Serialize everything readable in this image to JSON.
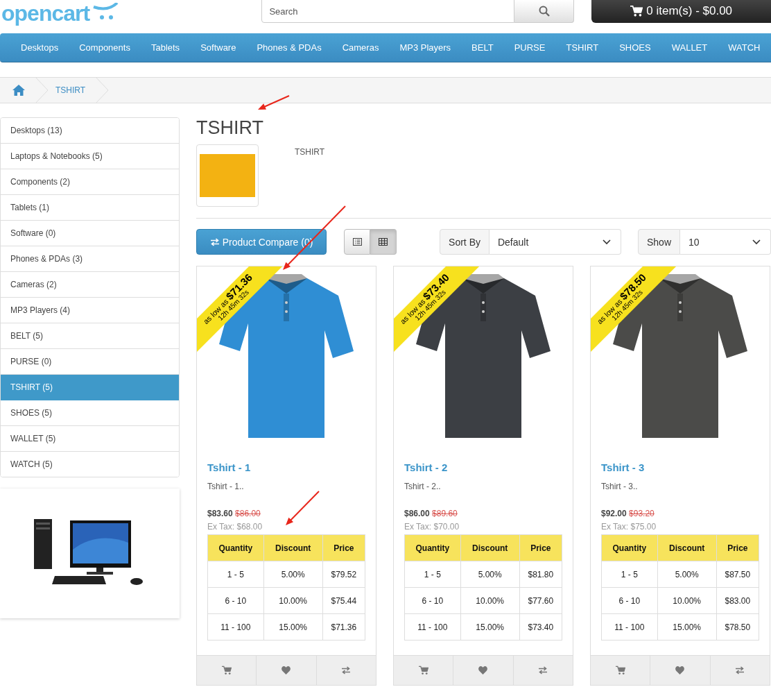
{
  "header": {
    "logo": "opencart",
    "search": {
      "placeholder": "Search"
    },
    "cart": "0 item(s) - $0.00"
  },
  "menu": [
    "Desktops",
    "Components",
    "Tablets",
    "Software",
    "Phones & PDAs",
    "Cameras",
    "MP3 Players",
    "BELT",
    "PURSE",
    "TSHIRT",
    "SHOES",
    "WALLET",
    "WATCH"
  ],
  "breadcrumb": [
    "TSHIRT"
  ],
  "categories": [
    {
      "label": "Desktops (13)",
      "selected": false
    },
    {
      "label": "Laptops & Notebooks (5)",
      "selected": false
    },
    {
      "label": "Components (2)",
      "selected": false
    },
    {
      "label": "Tablets (1)",
      "selected": false
    },
    {
      "label": "Software (0)",
      "selected": false
    },
    {
      "label": "Phones & PDAs (3)",
      "selected": false
    },
    {
      "label": "Cameras (2)",
      "selected": false
    },
    {
      "label": "MP3 Players (4)",
      "selected": false
    },
    {
      "label": "BELT (5)",
      "selected": false
    },
    {
      "label": "PURSE (0)",
      "selected": false
    },
    {
      "label": "TSHIRT (5)",
      "selected": true
    },
    {
      "label": "SHOES (5)",
      "selected": false
    },
    {
      "label": "WALLET (5)",
      "selected": false
    },
    {
      "label": "WATCH (5)",
      "selected": false
    }
  ],
  "category": {
    "title": "TSHIRT",
    "description": "TSHIRT"
  },
  "toolbar": {
    "compare": "Product Compare (0)",
    "views": [
      {
        "kind": "list",
        "selected": false
      },
      {
        "kind": "grid",
        "selected": true
      }
    ],
    "sort": {
      "label": "Sort By",
      "value": "Default"
    },
    "limit": {
      "label": "Show",
      "value": "10"
    }
  },
  "products": [
    {
      "name": "Tshirt - 1",
      "description": "Tshirt - 1..",
      "price": "$83.60",
      "old_price": "$86.00",
      "ex_tax": "Ex Tax: $68.00",
      "color": "#2f8ed4",
      "ribbon": {
        "offer": "as low as **$71.36**",
        "countdown": "12h 45m 32s"
      },
      "discounts": {
        "columns": [
          "Quantity",
          "Discount",
          "Price"
        ],
        "rows": [
          [
            "1 - 5",
            "5.00%",
            "$79.52"
          ],
          [
            "6 - 10",
            "10.00%",
            "$75.44"
          ],
          [
            "11 - 100",
            "15.00%",
            "$71.36"
          ]
        ]
      }
    },
    {
      "name": "Tshirt - 2",
      "description": "Tshirt - 2..",
      "price": "$86.00",
      "old_price": "$89.60",
      "ex_tax": "Ex Tax: $70.00",
      "color": "#3c3f44",
      "ribbon": {
        "offer": "as low as **$73.40**",
        "countdown": "12h 45m 32s"
      },
      "discounts": {
        "columns": [
          "Quantity",
          "Discount",
          "Price"
        ],
        "rows": [
          [
            "1 - 5",
            "5.00%",
            "$81.80"
          ],
          [
            "6 - 10",
            "10.00%",
            "$77.60"
          ],
          [
            "11 - 100",
            "15.00%",
            "$73.40"
          ]
        ]
      }
    },
    {
      "name": "Tshirt - 3",
      "description": "Tshirt - 3..",
      "price": "$92.00",
      "old_price": "$93.20",
      "ex_tax": "Ex Tax: $75.00",
      "color": "#4b4b49",
      "ribbon": {
        "offer": "as low as **$78.50**",
        "countdown": "12h 45m 32s"
      },
      "discounts": {
        "columns": [
          "Quantity",
          "Discount",
          "Price"
        ],
        "rows": [
          [
            "1 - 5",
            "5.00%",
            "$87.50"
          ],
          [
            "6 - 10",
            "10.00%",
            "$83.00"
          ],
          [
            "11 - 100",
            "15.00%",
            "$78.50"
          ]
        ]
      }
    }
  ]
}
